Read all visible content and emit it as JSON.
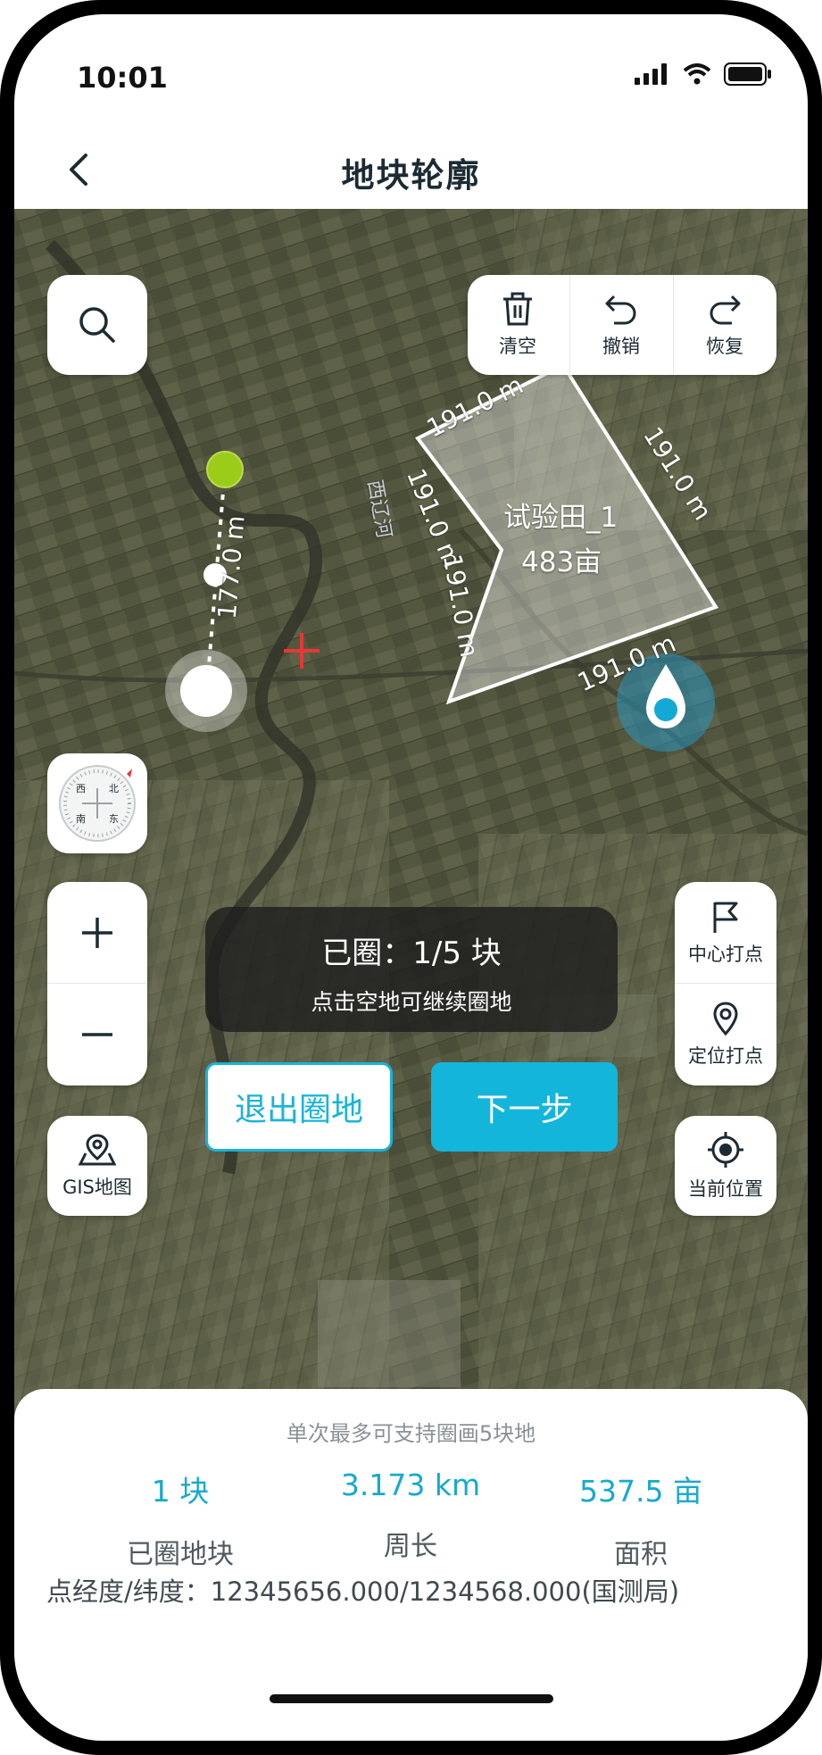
{
  "status_bar": {
    "time": "10:01"
  },
  "nav": {
    "title": "地块轮廓"
  },
  "toolbar": {
    "clear": "清空",
    "undo": "撤销",
    "redo": "恢复"
  },
  "compass": {
    "west": "西",
    "north": "北",
    "south": "南",
    "east": "东"
  },
  "zoom": {
    "plus": "+",
    "minus": "−"
  },
  "side_tools": {
    "center_point": "中心打点",
    "locate_point": "定位打点",
    "current_position": "当前位置",
    "gis_map": "GIS地图"
  },
  "map": {
    "river_label": "西辽河",
    "field_name": "试验田_1",
    "field_area": "483亩",
    "segment_top": "191.0 m",
    "segment_right": "191.0 m",
    "segment_left_upper": "191.0 m",
    "segment_left_lower": "191.0 m",
    "segment_bottom": "191.0 m",
    "segment_drawing": "177.0 m"
  },
  "info_box": {
    "count": "已圈：1/5 块",
    "hint": "点击空地可继续圈地"
  },
  "buttons": {
    "exit": "退出圈地",
    "next": "下一步"
  },
  "sheet": {
    "hint": "单次最多可支持圈画5块地",
    "stats": [
      {
        "value": "1 块",
        "label": "已圈地块"
      },
      {
        "value": "3.173 km",
        "label": "周长"
      },
      {
        "value": "537.5 亩",
        "label": "面积"
      }
    ],
    "coords": "点经度/纬度：12345656.000/1234568.000(国测局)"
  },
  "colors": {
    "accent": "#14b5db",
    "point_green": "#9ccc1a",
    "marker_red": "#e53935"
  }
}
